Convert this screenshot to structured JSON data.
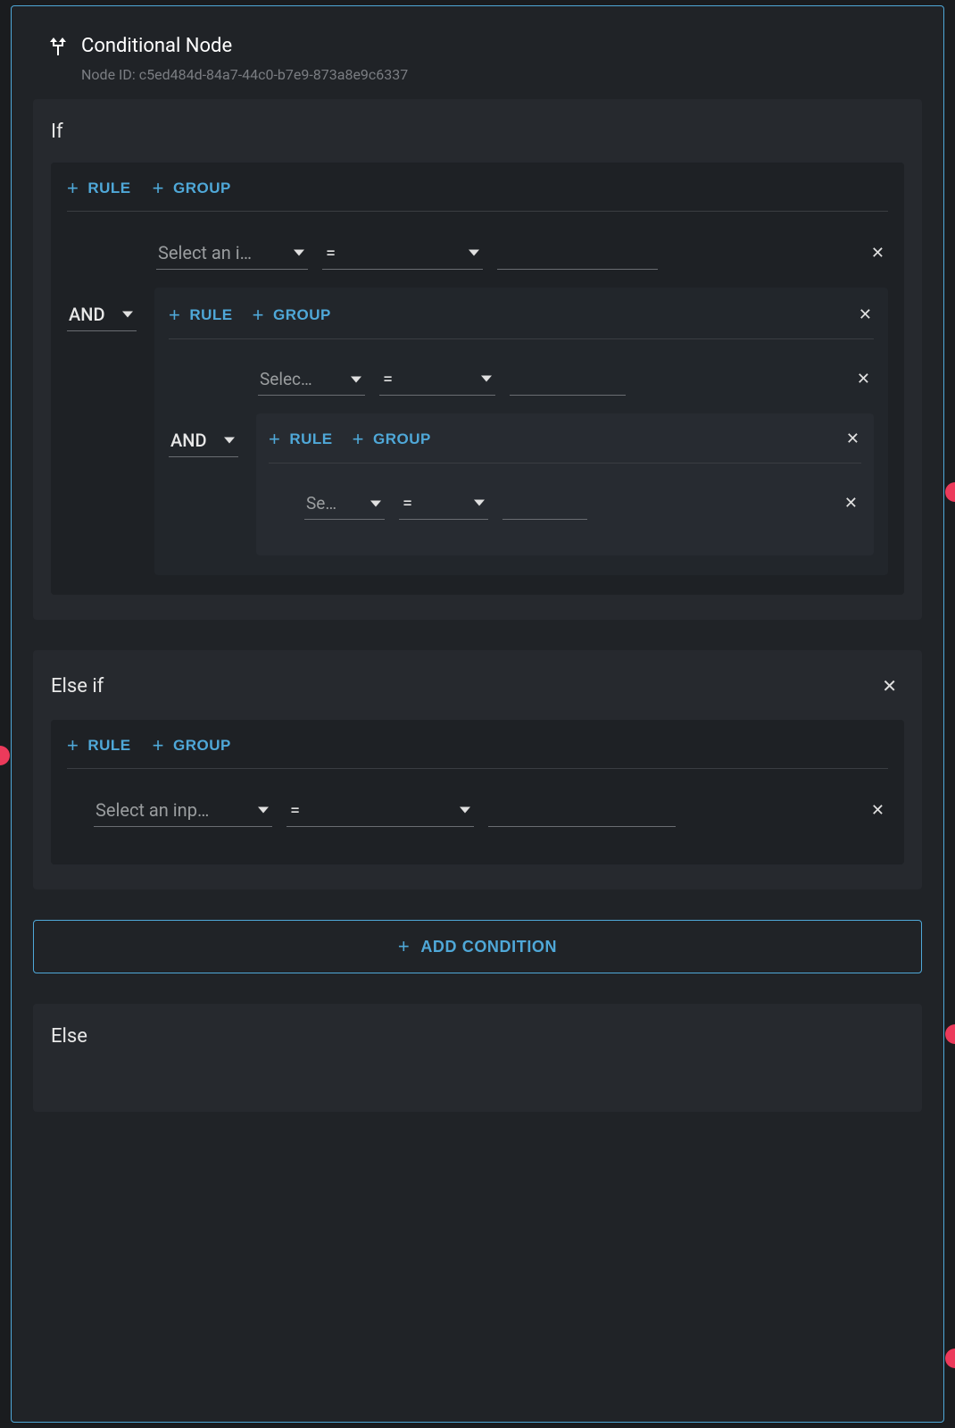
{
  "header": {
    "title": "Conditional Node",
    "node_id_label": "Node ID:",
    "node_id": "c5ed484d-84a7-44c0-b7e9-873a8e9c6337"
  },
  "buttons": {
    "rule": "RULE",
    "group": "GROUP",
    "add_condition": "ADD CONDITION"
  },
  "logic": {
    "and": "AND"
  },
  "operators": {
    "eq": "="
  },
  "placeholders": {
    "select_input_long": "Select an i…",
    "select_input_med": "Selec…",
    "select_input_short": "Se…",
    "select_input_elseif": "Select an inp…"
  },
  "sections": {
    "if": "If",
    "elseif": "Else if",
    "else": "Else"
  }
}
